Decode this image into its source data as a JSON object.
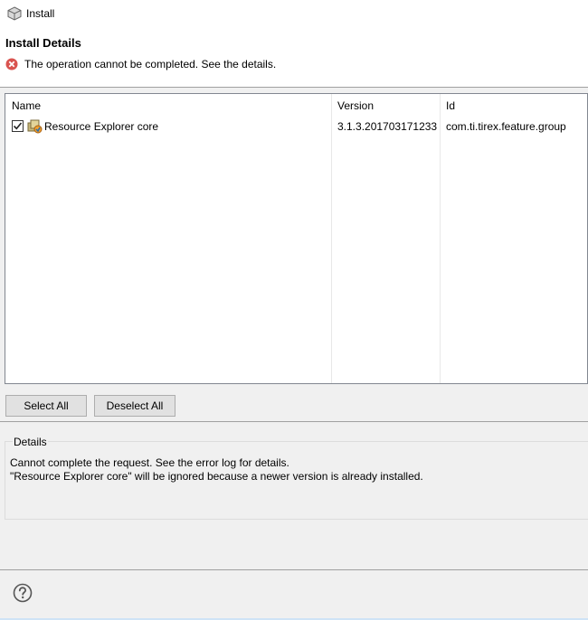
{
  "window": {
    "title": "Install",
    "icon": "box-icon"
  },
  "header": {
    "heading": "Install Details",
    "error_message": "The operation cannot be completed.  See the details."
  },
  "table": {
    "columns": [
      "Name",
      "Version",
      "Id"
    ],
    "rows": [
      {
        "checked": true,
        "name": "Resource Explorer core",
        "version": "3.1.3.201703171233",
        "id": "com.ti.tirex.feature.group"
      }
    ]
  },
  "buttons": {
    "select_all": "Select All",
    "deselect_all": "Deselect All"
  },
  "details": {
    "label": "Details",
    "lines": [
      "Cannot complete the request.  See the error log for details.",
      "\"Resource Explorer core\" will be ignored because a newer version is already installed."
    ]
  },
  "footer": {
    "help_icon": "help-icon"
  },
  "colors": {
    "error_red": "#d9534f",
    "window_bg": "#f0f0f0",
    "button_bg": "#e1e1e1"
  }
}
